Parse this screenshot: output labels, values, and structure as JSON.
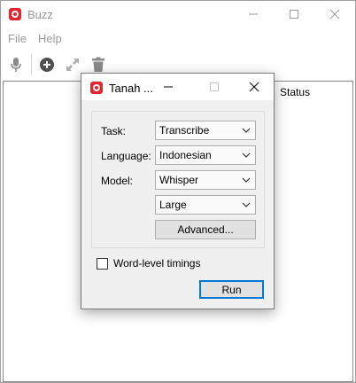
{
  "app": {
    "title": "Buzz",
    "brand_color": "#e2262f"
  },
  "window_controls": {
    "minimize_icon": "minimize-icon",
    "maximize_icon": "maximize-icon",
    "close_icon": "close-icon",
    "color": "#9a9a9a"
  },
  "menubar": {
    "items": [
      {
        "label": "File"
      },
      {
        "label": "Help"
      }
    ]
  },
  "toolbar": {
    "buttons": [
      {
        "name": "record",
        "icon": "microphone-icon"
      },
      {
        "name": "import",
        "icon": "plus-circle-icon"
      },
      {
        "name": "open",
        "icon": "expand-icon"
      },
      {
        "name": "delete",
        "icon": "trash-icon"
      }
    ]
  },
  "table": {
    "columns": [
      {
        "label": "Status"
      }
    ],
    "rows": []
  },
  "dialog": {
    "title": "Tanah ...",
    "task": {
      "label": "Task:",
      "value": "Transcribe"
    },
    "language": {
      "label": "Language:",
      "value": "Indonesian"
    },
    "model": {
      "label": "Model:",
      "value": "Whisper"
    },
    "model_size": {
      "value": "Large"
    },
    "advanced_button": "Advanced...",
    "word_level_timings": {
      "label": "Word-level timings",
      "checked": false
    },
    "run_button": "Run",
    "accent_color": "#0078d7"
  }
}
